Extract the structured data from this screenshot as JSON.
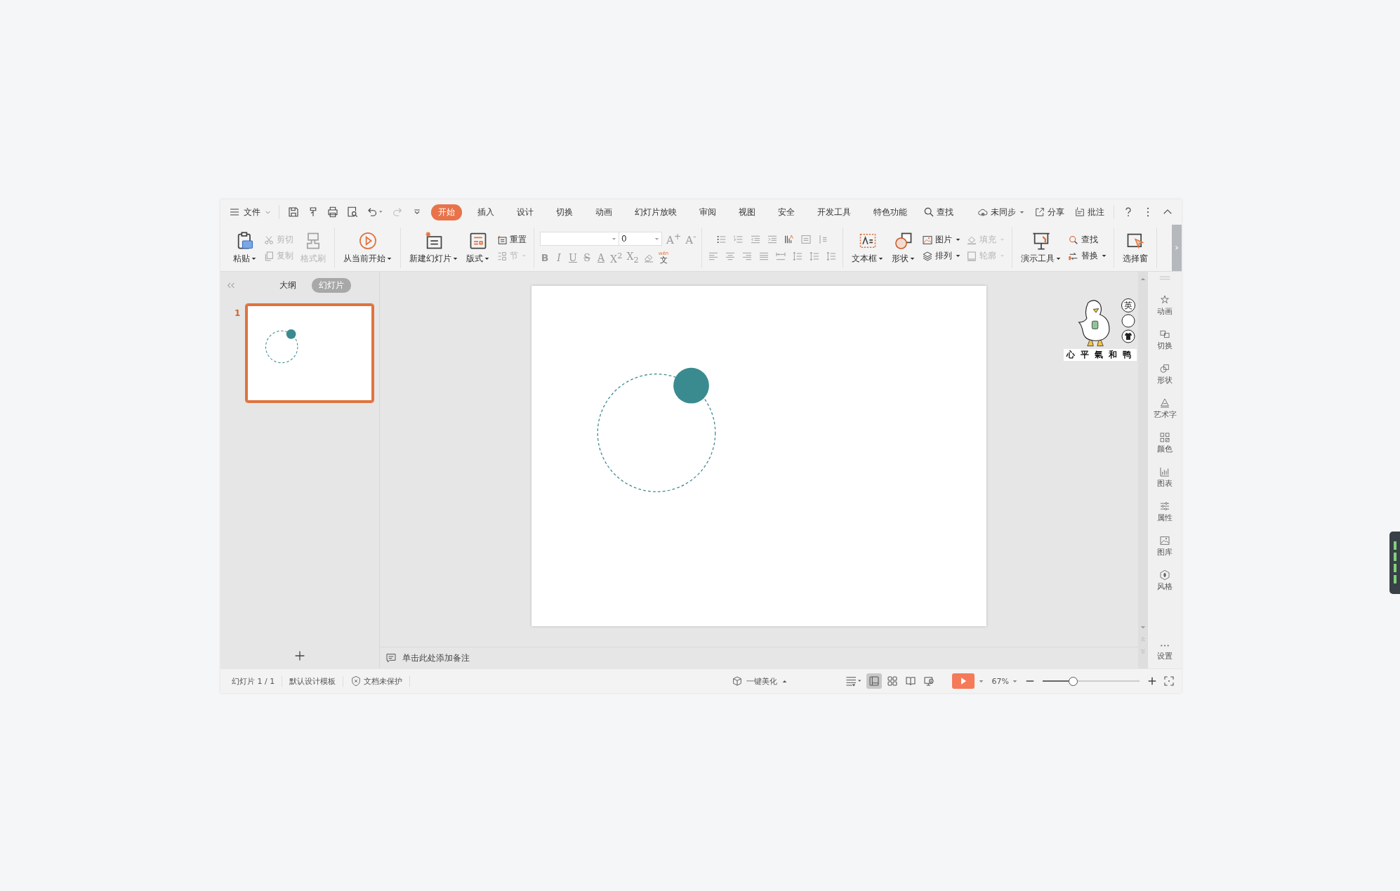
{
  "menu": {
    "file": "文件",
    "tabs": [
      {
        "label": "开始",
        "selected": true
      },
      {
        "label": "插入",
        "selected": false
      },
      {
        "label": "设计",
        "selected": false
      },
      {
        "label": "切换",
        "selected": false
      },
      {
        "label": "动画",
        "selected": false
      },
      {
        "label": "幻灯片放映",
        "selected": false
      },
      {
        "label": "审阅",
        "selected": false
      },
      {
        "label": "视图",
        "selected": false
      },
      {
        "label": "安全",
        "selected": false
      },
      {
        "label": "开发工具",
        "selected": false
      },
      {
        "label": "特色功能",
        "selected": false
      }
    ],
    "search": "查找",
    "sync": "未同步",
    "share": "分享",
    "comment": "批注"
  },
  "ribbon": [
    {
      "kind": "tools",
      "items": [
        {
          "kind": "large",
          "label": "粘贴",
          "caret": true,
          "disabled": false
        },
        {
          "kind": "stack",
          "items": [
            {
              "label": "剪切",
              "caret": false,
              "disabled": true
            },
            {
              "label": "复制",
              "caret": false,
              "disabled": true
            }
          ]
        },
        {
          "kind": "large",
          "label": "格式刷",
          "caret": false,
          "disabled": true
        }
      ]
    },
    {
      "kind": "tools",
      "items": [
        {
          "kind": "large",
          "label": "从当前开始",
          "caret": true,
          "disabled": false
        }
      ]
    },
    {
      "kind": "tools",
      "items": [
        {
          "kind": "large",
          "label": "新建幻灯片",
          "caret": true,
          "disabled": false
        },
        {
          "kind": "large",
          "label": "版式",
          "caret": true,
          "disabled": false
        },
        {
          "kind": "stack",
          "items": [
            {
              "label": "重置",
              "caret": false,
              "disabled": false
            },
            {
              "label": "节",
              "caret": true,
              "disabled": true
            }
          ]
        }
      ]
    },
    {
      "kind": "font",
      "size": "0",
      "grow": "A$^{+}$",
      "shrink": "A$^{-}$",
      "styles": [
        "B",
        "I",
        "U",
        "S",
        "A",
        "X$^{2}$",
        "X$_{2}$"
      ],
      "phonetic": {
        "ruby": "wén",
        "char": "文"
      }
    },
    {
      "kind": "paragraph"
    },
    {
      "kind": "tools",
      "items": [
        {
          "kind": "large",
          "label": "文本框",
          "caret": true,
          "disabled": false
        },
        {
          "kind": "large",
          "label": "形状",
          "caret": true,
          "disabled": false
        },
        {
          "kind": "stack",
          "items": [
            {
              "label": "图片",
              "caret": true,
              "disabled": false
            },
            {
              "label": "排列",
              "caret": true,
              "disabled": false
            }
          ]
        },
        {
          "kind": "stack",
          "items": [
            {
              "label": "填充",
              "caret": true,
              "disabled": true
            },
            {
              "label": "轮廓",
              "caret": true,
              "disabled": true
            }
          ]
        }
      ]
    },
    {
      "kind": "tools",
      "items": [
        {
          "kind": "large",
          "label": "演示工具",
          "caret": true,
          "disabled": false
        },
        {
          "kind": "stack",
          "items": [
            {
              "label": "查找",
              "caret": false,
              "disabled": false
            },
            {
              "label": "替换",
              "caret": true,
              "disabled": false
            }
          ]
        }
      ]
    },
    {
      "kind": "tools",
      "items": [
        {
          "kind": "large",
          "label": "选择窗",
          "caret": false,
          "disabled": false
        }
      ]
    }
  ],
  "panel": {
    "tabs": [
      {
        "label": "大纲",
        "selected": false
      },
      {
        "label": "幻灯片",
        "selected": true
      }
    ],
    "slides": [
      {
        "number": "1",
        "selected": true
      }
    ]
  },
  "notes": {
    "placeholder": "单击此处添加备注"
  },
  "sidebar": [
    {
      "label": "动画"
    },
    {
      "label": "切换"
    },
    {
      "label": "形状"
    },
    {
      "label": "艺术字"
    },
    {
      "label": "颜色"
    },
    {
      "label": "图表"
    },
    {
      "label": "属性"
    },
    {
      "label": "图库"
    },
    {
      "label": "风格"
    },
    {
      "label": "设置"
    }
  ],
  "overlay": {
    "caption": "心平氣和鸭",
    "language": "英"
  },
  "status": {
    "items": [
      "幻灯片 1 / 1",
      "默认设计模板",
      "文档未保护"
    ],
    "beautify": "一键美化",
    "views": [
      {
        "selected": true
      },
      {
        "selected": false
      },
      {
        "selected": false
      },
      {
        "selected": false
      }
    ],
    "zoom": "67%",
    "zoom_level": {
      "level": 0.31
    }
  }
}
